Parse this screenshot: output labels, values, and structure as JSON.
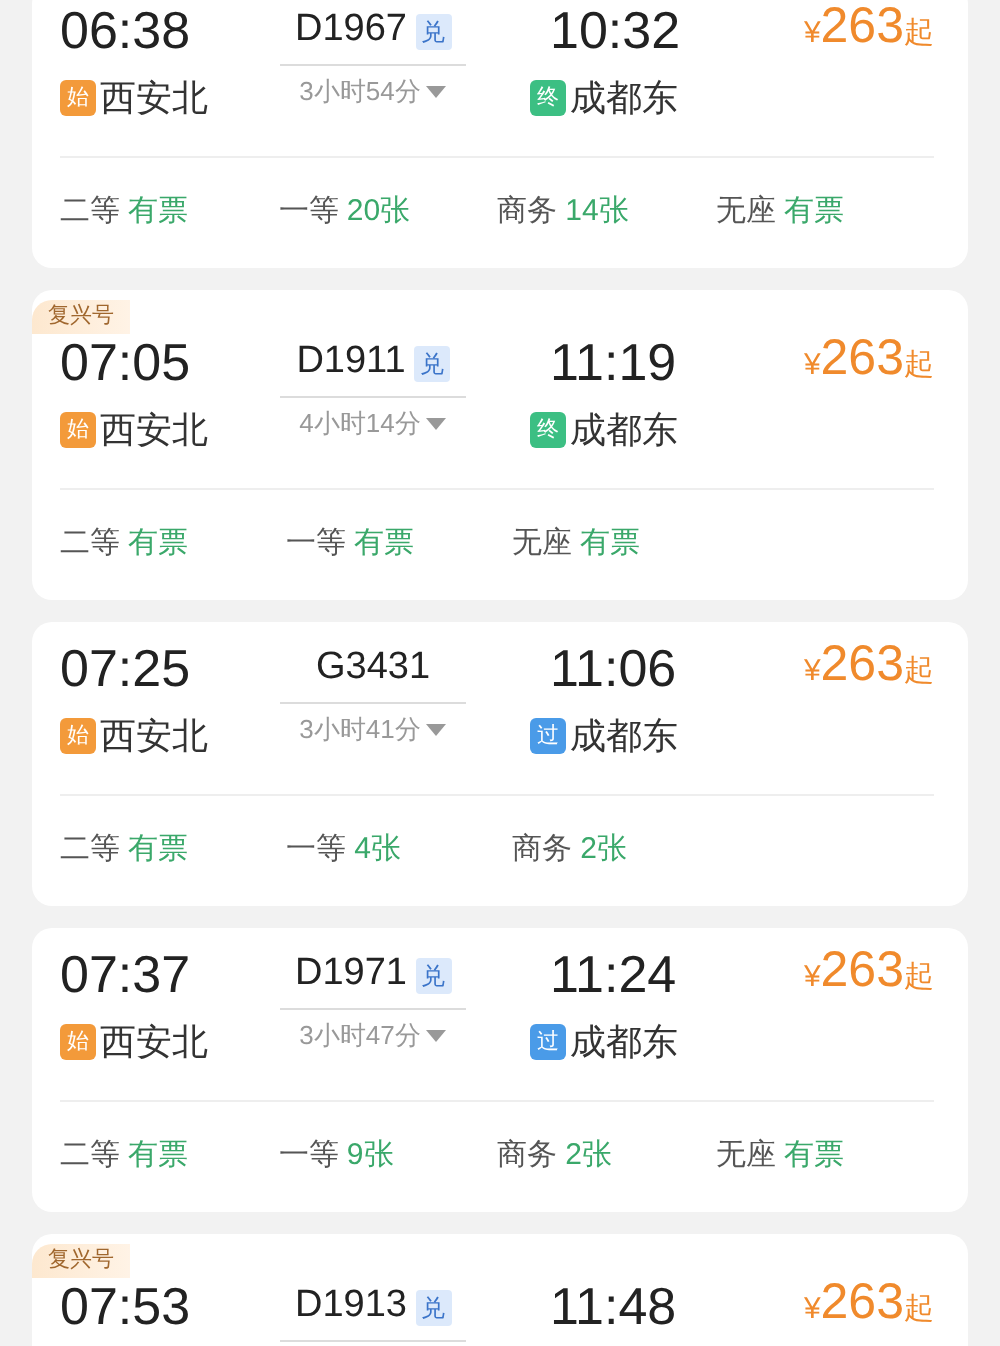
{
  "trains": [
    {
      "depart_time": "06:38",
      "train_no": "D1967",
      "tag": "兑",
      "arrive_time": "10:32",
      "currency": "¥",
      "price": "263",
      "price_suffix": "起",
      "from": {
        "mark": "始",
        "kind": "start",
        "name": "西安北"
      },
      "duration": "3小时54分",
      "to": {
        "mark": "终",
        "kind": "end",
        "name": "成都东"
      },
      "seats": [
        {
          "class": "二等",
          "avail": "有票"
        },
        {
          "class": "一等",
          "avail": "20张"
        },
        {
          "class": "商务",
          "avail": "14张"
        },
        {
          "class": "无座",
          "avail": "有票"
        }
      ]
    },
    {
      "badge": "复兴号",
      "depart_time": "07:05",
      "train_no": "D1911",
      "tag": "兑",
      "arrive_time": "11:19",
      "currency": "¥",
      "price": "263",
      "price_suffix": "起",
      "from": {
        "mark": "始",
        "kind": "start",
        "name": "西安北"
      },
      "duration": "4小时14分",
      "to": {
        "mark": "终",
        "kind": "end",
        "name": "成都东"
      },
      "seats": [
        {
          "class": "二等",
          "avail": "有票"
        },
        {
          "class": "一等",
          "avail": "有票"
        },
        {
          "class": "无座",
          "avail": "有票"
        }
      ]
    },
    {
      "depart_time": "07:25",
      "train_no": "G3431",
      "arrive_time": "11:06",
      "currency": "¥",
      "price": "263",
      "price_suffix": "起",
      "from": {
        "mark": "始",
        "kind": "start",
        "name": "西安北"
      },
      "duration": "3小时41分",
      "to": {
        "mark": "过",
        "kind": "pass",
        "name": "成都东"
      },
      "seats": [
        {
          "class": "二等",
          "avail": "有票"
        },
        {
          "class": "一等",
          "avail": "4张"
        },
        {
          "class": "商务",
          "avail": "2张"
        }
      ]
    },
    {
      "depart_time": "07:37",
      "train_no": "D1971",
      "tag": "兑",
      "arrive_time": "11:24",
      "currency": "¥",
      "price": "263",
      "price_suffix": "起",
      "from": {
        "mark": "始",
        "kind": "start",
        "name": "西安北"
      },
      "duration": "3小时47分",
      "to": {
        "mark": "过",
        "kind": "pass",
        "name": "成都东"
      },
      "seats": [
        {
          "class": "二等",
          "avail": "有票"
        },
        {
          "class": "一等",
          "avail": "9张"
        },
        {
          "class": "商务",
          "avail": "2张"
        },
        {
          "class": "无座",
          "avail": "有票"
        }
      ]
    },
    {
      "badge": "复兴号",
      "depart_time": "07:53",
      "train_no": "D1913",
      "tag": "兑",
      "arrive_time": "11:48",
      "currency": "¥",
      "price": "263",
      "price_suffix": "起"
    }
  ]
}
